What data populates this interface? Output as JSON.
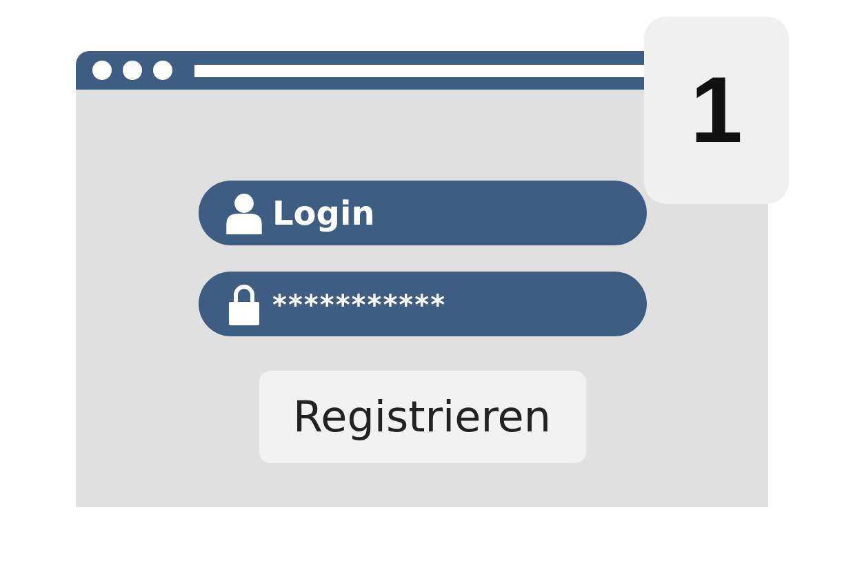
{
  "step_badge": "1",
  "login_field": {
    "value": "Login"
  },
  "password_field": {
    "value": "***********"
  },
  "register_button": {
    "label": "Registrieren"
  }
}
